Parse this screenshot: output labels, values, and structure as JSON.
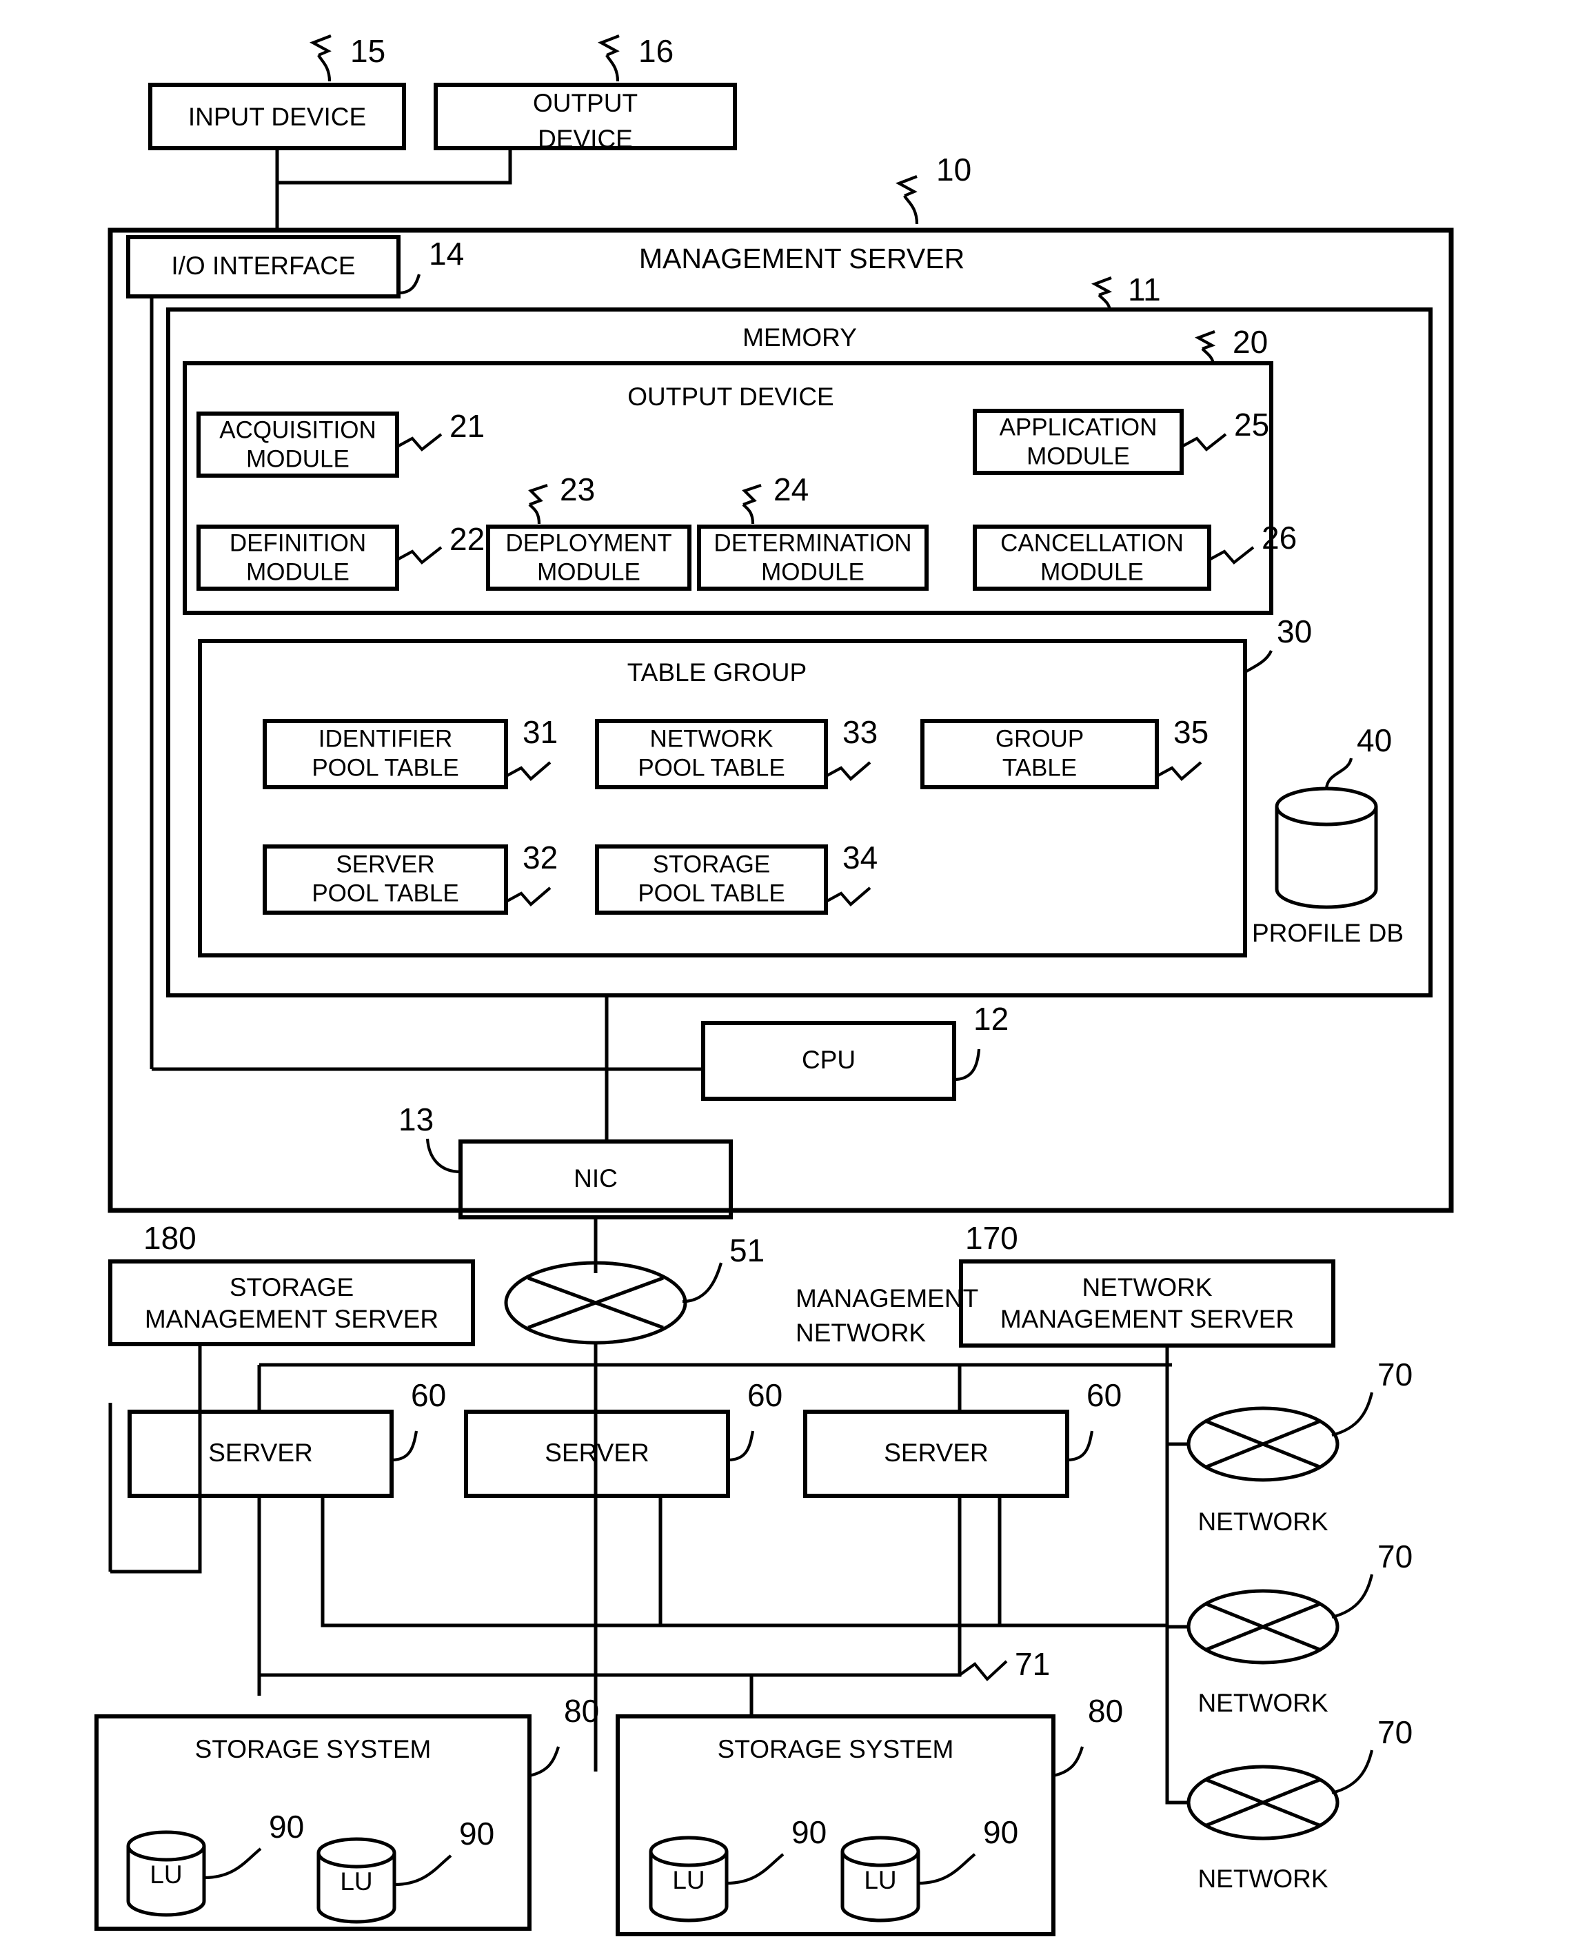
{
  "figure": {
    "title": "Management server system block diagram",
    "top_devices": [
      {
        "label": "INPUT DEVICE",
        "ref": "15"
      },
      {
        "label_line1": "OUTPUT",
        "label_line2": "DEVICE",
        "ref": "16"
      }
    ],
    "management_server": {
      "title": "MANAGEMENT SERVER",
      "ref": "10",
      "io_interface": {
        "label": "I/O INTERFACE",
        "ref": "14"
      },
      "memory": {
        "title": "MEMORY",
        "ref": "11",
        "program_area": {
          "title": "OUTPUT DEVICE",
          "ref": "20",
          "modules": [
            {
              "line1": "ACQUISITION",
              "line2": "MODULE",
              "ref": "21"
            },
            {
              "line1": "DEFINITION",
              "line2": "MODULE",
              "ref": "22"
            },
            {
              "line1": "DEPLOYMENT",
              "line2": "MODULE",
              "ref": "23"
            },
            {
              "line1": "DETERMINATION",
              "line2": "MODULE",
              "ref": "24"
            },
            {
              "line1": "APPLICATION",
              "line2": "MODULE",
              "ref": "25"
            },
            {
              "line1": "CANCELLATION",
              "line2": "MODULE",
              "ref": "26"
            }
          ]
        },
        "table_group": {
          "title": "TABLE GROUP",
          "ref": "30",
          "tables": [
            {
              "line1": "IDENTIFIER",
              "line2": "POOL TABLE",
              "ref": "31"
            },
            {
              "line1": "SERVER",
              "line2": "POOL TABLE",
              "ref": "32"
            },
            {
              "line1": "NETWORK",
              "line2": "POOL TABLE",
              "ref": "33"
            },
            {
              "line1": "STORAGE",
              "line2": "POOL TABLE",
              "ref": "34"
            },
            {
              "line1": "GROUP",
              "line2": "TABLE",
              "ref": "35"
            }
          ]
        },
        "profile_db": {
          "label": "PROFILE DB",
          "ref": "40"
        }
      },
      "cpu": {
        "label": "CPU",
        "ref": "12"
      },
      "nic": {
        "label": "NIC",
        "ref": "13"
      }
    },
    "management_network": {
      "line1": "MANAGEMENT",
      "line2": "NETWORK",
      "ref": "51"
    },
    "storage_management_server": {
      "line1": "STORAGE",
      "line2": "MANAGEMENT SERVER",
      "ref": "180"
    },
    "network_management_server": {
      "line1": "NETWORK",
      "line2": "MANAGEMENT SERVER",
      "ref": "170"
    },
    "servers": [
      {
        "label": "SERVER",
        "ref": "60"
      },
      {
        "label": "SERVER",
        "ref": "60"
      },
      {
        "label": "SERVER",
        "ref": "60"
      }
    ],
    "networks": [
      {
        "label": "NETWORK",
        "ref": "70"
      },
      {
        "label": "NETWORK",
        "ref": "70"
      },
      {
        "label": "NETWORK",
        "ref": "70"
      }
    ],
    "data_network": {
      "ref": "71"
    },
    "storage_systems": [
      {
        "label": "STORAGE SYSTEM",
        "ref": "80",
        "lus": [
          {
            "label": "LU",
            "ref": "90"
          },
          {
            "label": "LU",
            "ref": "90"
          }
        ]
      },
      {
        "label": "STORAGE SYSTEM",
        "ref": "80",
        "lus": [
          {
            "label": "LU",
            "ref": "90"
          },
          {
            "label": "LU",
            "ref": "90"
          }
        ]
      }
    ]
  }
}
